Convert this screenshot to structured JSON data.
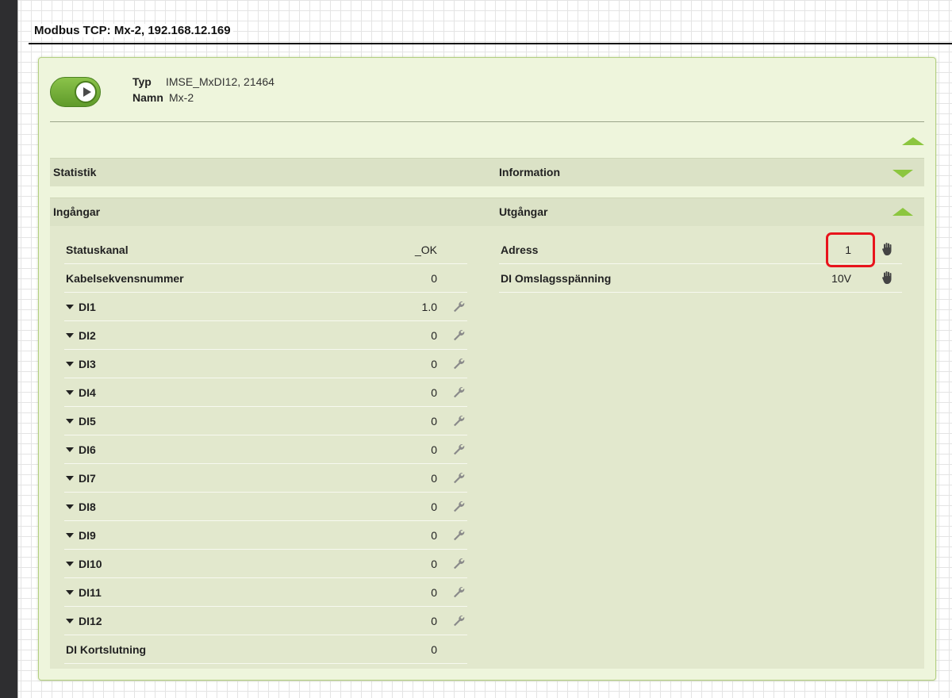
{
  "page": {
    "title": "Modbus TCP: Mx-2, 192.168.12.169"
  },
  "device": {
    "type_label": "Typ",
    "type_value": "IMSE_MxDI12, 21464",
    "name_label": "Namn",
    "name_value": "Mx-2",
    "enabled": true
  },
  "sections": {
    "statistik": "Statistik",
    "information": "Information",
    "ingangar": "Ingångar",
    "utgangar": "Utgångar"
  },
  "inputs": [
    {
      "name": "Statuskanal",
      "value": "_OK"
    },
    {
      "name": "Kabelsekvensnummer",
      "value": "0"
    },
    {
      "name": "DI1",
      "value": "1.0",
      "icon": "wrench-icon",
      "expandable": true
    },
    {
      "name": "DI2",
      "value": "0",
      "icon": "wrench-icon",
      "expandable": true
    },
    {
      "name": "DI3",
      "value": "0",
      "icon": "wrench-icon",
      "expandable": true
    },
    {
      "name": "DI4",
      "value": "0",
      "icon": "wrench-icon",
      "expandable": true
    },
    {
      "name": "DI5",
      "value": "0",
      "icon": "wrench-icon",
      "expandable": true
    },
    {
      "name": "DI6",
      "value": "0",
      "icon": "wrench-icon",
      "expandable": true
    },
    {
      "name": "DI7",
      "value": "0",
      "icon": "wrench-icon",
      "expandable": true
    },
    {
      "name": "DI8",
      "value": "0",
      "icon": "wrench-icon",
      "expandable": true
    },
    {
      "name": "DI9",
      "value": "0",
      "icon": "wrench-icon",
      "expandable": true
    },
    {
      "name": "DI10",
      "value": "0",
      "icon": "wrench-icon",
      "expandable": true
    },
    {
      "name": "DI11",
      "value": "0",
      "icon": "wrench-icon",
      "expandable": true
    },
    {
      "name": "DI12",
      "value": "0",
      "icon": "wrench-icon",
      "expandable": true
    },
    {
      "name": "DI Kortslutning",
      "value": "0"
    }
  ],
  "outputs": [
    {
      "name": "Adress",
      "value": "1",
      "icon": "hand-icon",
      "highlighted": true
    },
    {
      "name": "DI Omslagsspänning",
      "value": "10V",
      "icon": "hand-icon"
    }
  ],
  "colors": {
    "accent": "#8cc63f",
    "panel_bg": "#eef5dc",
    "section_bg": "#dbe2c6",
    "highlight": "#e8141c"
  }
}
